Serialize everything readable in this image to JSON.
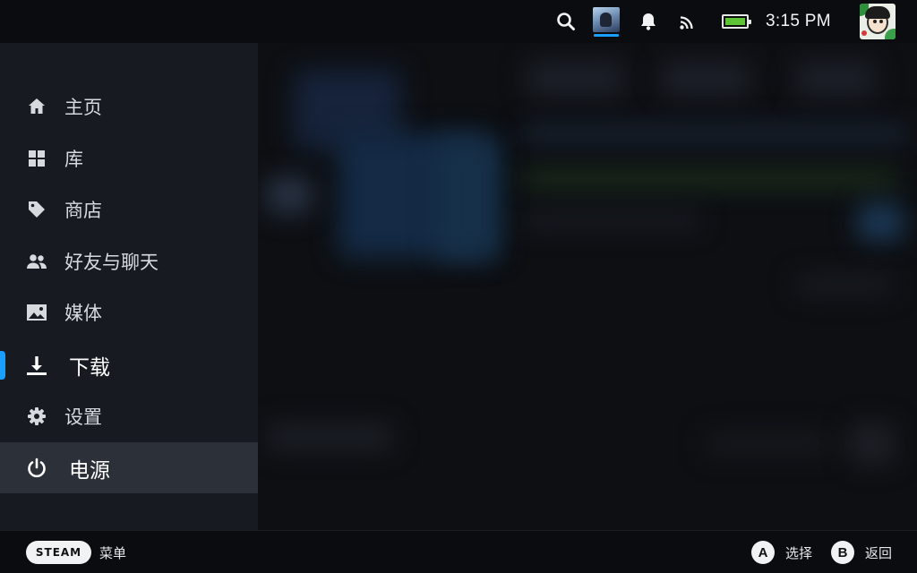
{
  "topbar": {
    "time": "3:15 PM",
    "icons": [
      "search-icon",
      "game-thumbnail",
      "bell-icon",
      "cast-icon",
      "battery-icon",
      "avatar"
    ],
    "battery_level": 1.0,
    "accent_color": "#1a9fff",
    "battery_color": "#5ec335"
  },
  "sidemenu": {
    "items": [
      {
        "label": "主页",
        "icon": "home-icon"
      },
      {
        "label": "库",
        "icon": "grid-icon"
      },
      {
        "label": "商店",
        "icon": "tag-icon"
      },
      {
        "label": "好友与聊天",
        "icon": "friends-icon"
      },
      {
        "label": "媒体",
        "icon": "image-icon"
      },
      {
        "label": "下载",
        "icon": "download-icon"
      },
      {
        "label": "设置",
        "icon": "gear-icon"
      },
      {
        "label": "电源",
        "icon": "power-icon"
      }
    ],
    "active_item": "下载",
    "focused_item": "电源"
  },
  "bottombar": {
    "steam_label": "STEAM",
    "menu_label": "菜单",
    "a_button": "A",
    "a_label": "选择",
    "b_button": "B",
    "b_label": "返回"
  }
}
